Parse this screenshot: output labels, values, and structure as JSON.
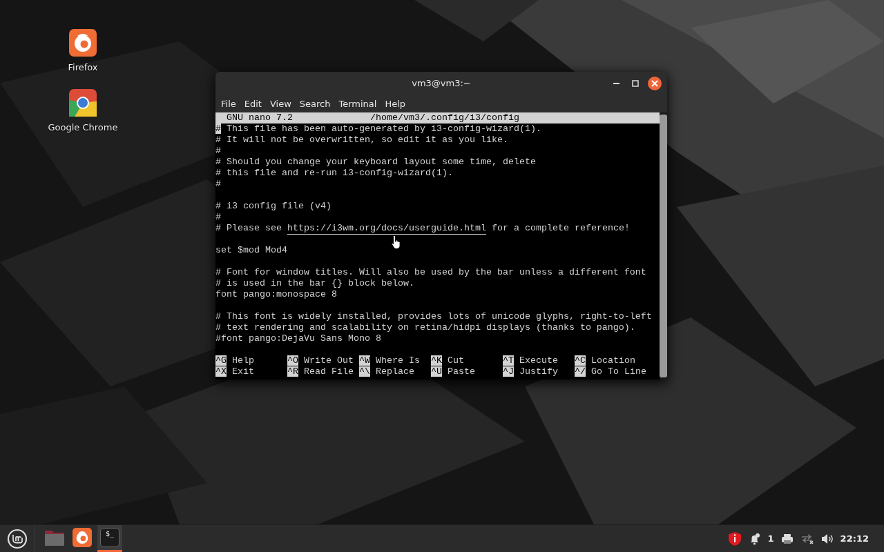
{
  "desktop": {
    "icons": [
      {
        "label": "Firefox",
        "kind": "firefox"
      },
      {
        "label": "Google Chrome",
        "kind": "chrome"
      }
    ]
  },
  "window": {
    "title": "vm3@vm3:~",
    "menu": [
      "File",
      "Edit",
      "View",
      "Search",
      "Terminal",
      "Help"
    ],
    "editor": {
      "app": "GNU nano 7.2",
      "file": "/home/vm3/.config/i3/config",
      "lines": [
        {
          "text": "# This file has been auto-generated by i3-config-wizard(1).",
          "cursor": true
        },
        {
          "text": "# It will not be overwritten, so edit it as you like.",
          "cursor": false
        },
        {
          "text": "#",
          "cursor": false
        },
        {
          "text": "# Should you change your keyboard layout some time, delete",
          "cursor": false
        },
        {
          "text": "# this file and re-run i3-config-wizard(1).",
          "cursor": false
        },
        {
          "text": "#",
          "cursor": false
        },
        {
          "cursor": false
        },
        {
          "text": "# i3 config file (v4)",
          "cursor": false
        },
        {
          "text": "#",
          "cursor": false
        },
        {
          "segments": [
            {
              "kind": "plain",
              "text": "# Please see "
            },
            {
              "kind": "link",
              "text": "https://i3wm.org/docs/userguide.html"
            },
            {
              "kind": "plain",
              "text": " for a complete reference!"
            }
          ],
          "cursor": false
        },
        {
          "cursor": false
        },
        {
          "text": "set $mod Mod4",
          "cursor": false
        },
        {
          "cursor": false
        },
        {
          "text": "# Font for window titles. Will also be used by the bar unless a different font",
          "cursor": false
        },
        {
          "text": "# is used in the bar {} block below.",
          "cursor": false
        },
        {
          "text": "font pango:monospace 8",
          "cursor": false
        },
        {
          "cursor": false
        },
        {
          "text": "# This font is widely installed, provides lots of unicode glyphs, right-to-left",
          "cursor": false
        },
        {
          "text": "# text rendering and scalability on retina/hidpi displays (thanks to pango).",
          "cursor": false
        },
        {
          "text": "#font pango:DejaVu Sans Mono 8",
          "cursor": false
        },
        {
          "cursor": false
        }
      ],
      "shortcuts": [
        [
          {
            "key": "^G",
            "label": "Help"
          },
          {
            "key": "^O",
            "label": "Write Out"
          },
          {
            "key": "^W",
            "label": "Where Is"
          },
          {
            "key": "^K",
            "label": "Cut"
          },
          {
            "key": "^T",
            "label": "Execute"
          },
          {
            "key": "^C",
            "label": "Location"
          }
        ],
        [
          {
            "key": "^X",
            "label": "Exit"
          },
          {
            "key": "^R",
            "label": "Read File"
          },
          {
            "key": "^\\",
            "label": "Replace"
          },
          {
            "key": "^U",
            "label": "Paste"
          },
          {
            "key": "^J",
            "label": "Justify"
          },
          {
            "key": "^/",
            "label": "Go To Line"
          }
        ]
      ]
    }
  },
  "taskbar": {
    "launchers": [
      {
        "kind": "files",
        "active": false
      },
      {
        "kind": "firefox",
        "active": false
      },
      {
        "kind": "terminal",
        "active": true,
        "glyph": "$_"
      }
    ],
    "notification_count": "1",
    "clock": "22:12"
  }
}
